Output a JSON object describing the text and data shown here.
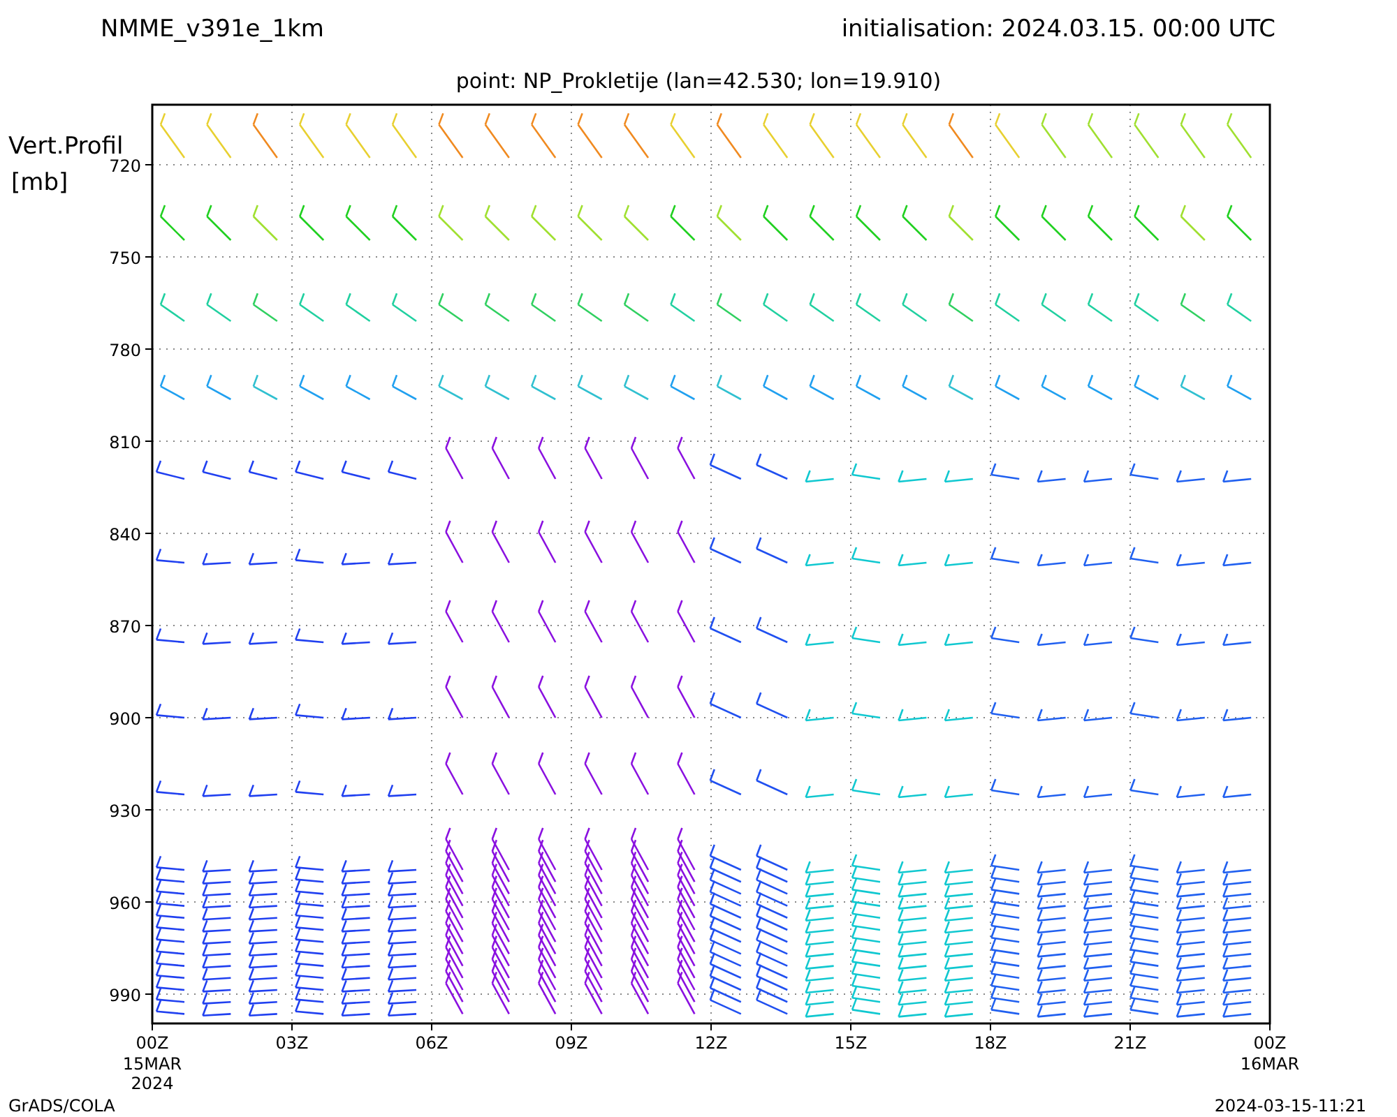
{
  "header": {
    "title": "NMME_v391e_1km",
    "initialisation": "initialisation:  2024.03.15.  00:00  UTC",
    "point": "point:  NP_Prokletije  (lan=42.530;  lon=19.910)"
  },
  "y_axis": {
    "label_lines": [
      "Vert.Profil",
      "[mb]"
    ],
    "ticks": [
      "720",
      "750",
      "780",
      "810",
      "840",
      "870",
      "900",
      "930",
      "960",
      "990"
    ]
  },
  "x_axis": {
    "ticks": [
      {
        "label": "00Z",
        "sub": [
          "15MAR",
          "2024"
        ]
      },
      {
        "label": "03Z"
      },
      {
        "label": "06Z"
      },
      {
        "label": "09Z"
      },
      {
        "label": "12Z"
      },
      {
        "label": "15Z"
      },
      {
        "label": "18Z"
      },
      {
        "label": "21Z"
      },
      {
        "label": "00Z",
        "sub": [
          "16MAR"
        ]
      }
    ]
  },
  "footer": {
    "left": "GrADS/COLA",
    "right": "2024-03-15-11:21"
  }
}
